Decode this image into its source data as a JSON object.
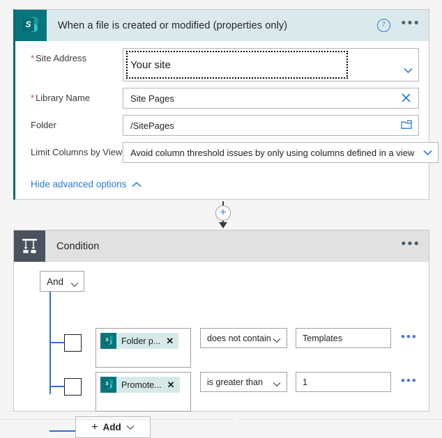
{
  "trigger": {
    "icon": "sharepoint-icon",
    "icon_letter": "S",
    "title": "When a file is created or modified (properties only)",
    "help_icon": "help-circle-icon",
    "more_icon": "ellipsis-icon",
    "fields": [
      {
        "label": "Site Address",
        "required": true,
        "value": "Your site",
        "trailing_icon": "chevron-down-icon",
        "highlighted": true
      },
      {
        "label": "Library Name",
        "required": true,
        "value": "Site Pages",
        "trailing_icon": "clear-x-icon",
        "highlighted": false
      },
      {
        "label": "Folder",
        "required": false,
        "value": "/SitePages",
        "trailing_icon": "folder-picker-icon",
        "highlighted": false
      },
      {
        "label": "Limit Columns by View",
        "required": false,
        "value": "Avoid column threshold issues by only using columns defined in a view",
        "trailing_icon": "chevron-down-icon",
        "highlighted": false
      }
    ],
    "advanced_link": "Hide advanced options",
    "advanced_icon": "chevron-up-icon",
    "required_marker": "*"
  },
  "connector": {
    "add_step_icon": "plus-circle-icon",
    "add_step_label": "+"
  },
  "condition": {
    "icon": "condition-branch-icon",
    "title": "Condition",
    "more_icon": "ellipsis-icon",
    "logic_operator": "And",
    "logic_chevron": "chevron-down-icon",
    "rows": [
      {
        "checkbox_checked": false,
        "token_label": "Folder p...",
        "token_icon": "sharepoint-icon",
        "token_remove_icon": "close-x-icon",
        "operator": "does not contain",
        "operator_chevron": "chevron-down-icon",
        "value": "Templates",
        "more_icon": "ellipsis-icon"
      },
      {
        "checkbox_checked": false,
        "token_label": "Promote...",
        "token_icon": "sharepoint-icon",
        "token_remove_icon": "close-x-icon",
        "operator": "is greater than",
        "operator_chevron": "chevron-down-icon",
        "value": "1",
        "more_icon": "ellipsis-icon"
      }
    ],
    "add_button": {
      "label": "Add",
      "plus_icon": "plus-icon",
      "chevron_icon": "chevron-down-icon"
    }
  },
  "colors": {
    "sharepoint_teal": "#036c70",
    "trigger_header": "#dce9ec",
    "condition_header": "#e1e1e1",
    "condition_icon": "#4a525e",
    "link_blue": "#2b7cd3",
    "tree_blue": "#2f6fd0",
    "required_red": "#e04343",
    "page_background": "#f5f5f5"
  }
}
